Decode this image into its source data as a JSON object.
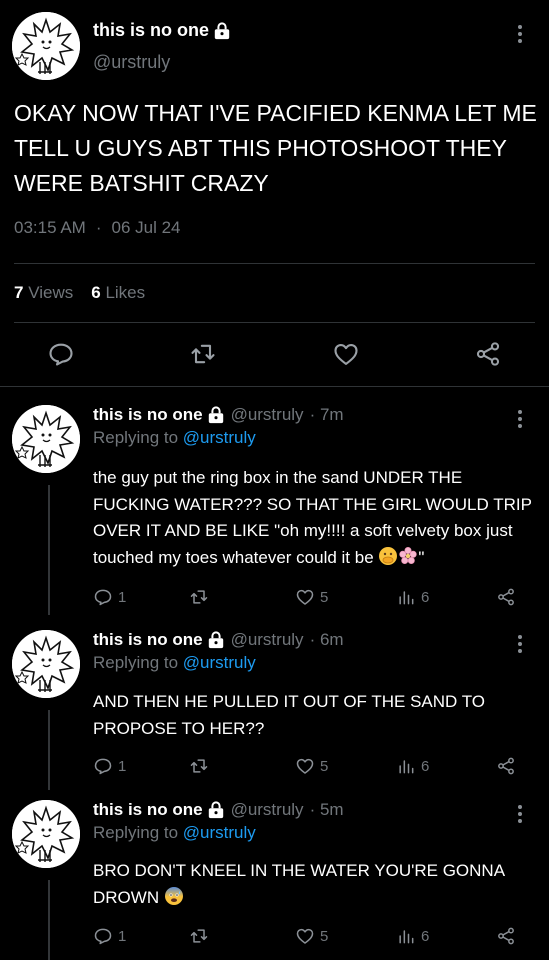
{
  "main_tweet": {
    "name": "this is no one",
    "handle": "@urstruly",
    "text": "OKAY NOW THAT I'VE PACIFIED KENMA LET ME TELL U GUYS ABT THIS PHOTOSHOOT THEY WERE BATSHIT CRAZY",
    "time": "03:15 AM",
    "separator": "·",
    "date": "06 Jul 24",
    "views_count": "7",
    "views_label": "Views",
    "likes_count": "6",
    "likes_label": "Likes"
  },
  "replies": [
    {
      "name": "this is no one",
      "handle": "@urstruly",
      "age": "· 7m",
      "replying_prefix": "Replying to",
      "replying_to": "@urstruly",
      "body": "the guy put the ring box in the sand UNDER THE FUCKING WATER??? SO THAT THE GIRL WOULD TRIP OVER IT AND BE LIKE \"oh my!!!! a soft velvety box just touched my toes whatever could it be",
      "body_end": "\"",
      "emojis": [
        "hand-over-mouth-emoji",
        "cherry-blossom-emoji"
      ],
      "replies": "1",
      "retweets": "",
      "likes": "5",
      "views": "6"
    },
    {
      "name": "this is no one",
      "handle": "@urstruly",
      "age": "· 6m",
      "replying_prefix": "Replying to",
      "replying_to": "@urstruly",
      "body": "AND THEN HE PULLED IT OUT OF THE SAND TO PROPOSE TO HER??",
      "body_end": "",
      "emojis": [],
      "replies": "1",
      "retweets": "",
      "likes": "5",
      "views": "6"
    },
    {
      "name": "this is no one",
      "handle": "@urstruly",
      "age": "· 5m",
      "replying_prefix": "Replying to",
      "replying_to": "@urstruly",
      "body": "BRO DON'T KNEEL IN THE WATER YOU'RE GONNA DROWN",
      "body_end": "",
      "emojis": [
        "anxious-face-emoji"
      ],
      "replies": "1",
      "retweets": "",
      "likes": "5",
      "views": "6"
    }
  ],
  "icons": {
    "reply": "reply-icon",
    "retweet": "retweet-icon",
    "like": "heart-icon",
    "views": "views-icon",
    "share": "share-icon",
    "more": "more-icon",
    "lock": "lock-icon"
  },
  "colors": {
    "background": "#000000",
    "text": "#e7e9ea",
    "muted": "#71767b",
    "link": "#1d9bf0",
    "divider": "#2f3336"
  }
}
